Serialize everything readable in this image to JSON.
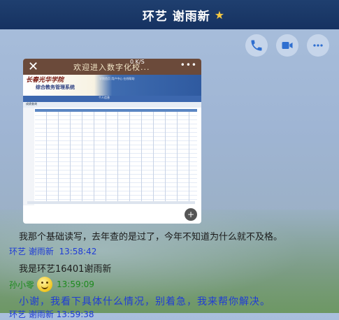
{
  "window": {
    "title": "环艺 谢雨新"
  },
  "toolbar": {
    "icons": [
      "phone-icon",
      "video-icon",
      "more-icon"
    ]
  },
  "image_message": {
    "top_title": "欢迎进入数字化校...",
    "speed": "0 K/S",
    "logo_line1": "长春光华学院",
    "logo_line2": "综合教务管理系统",
    "header_links": "学院首页 用户中心 在线帮助",
    "nav_text": "个人信息",
    "sub_text": "成绩查询"
  },
  "messages": [
    {
      "text": "我那个基础读写，去年查的是过了，今年不知道为什么就不及格。"
    },
    {
      "sender": "环艺 谢雨新",
      "time": "13:58:42",
      "text": "我是环艺16401谢雨新"
    },
    {
      "sender": "孙小零",
      "time": "13:59:09",
      "text": "小谢，我看下具体什么情况，别着急，我来帮你解决。"
    }
  ],
  "partial_sender": "环艺 谢雨新 13:59:38"
}
